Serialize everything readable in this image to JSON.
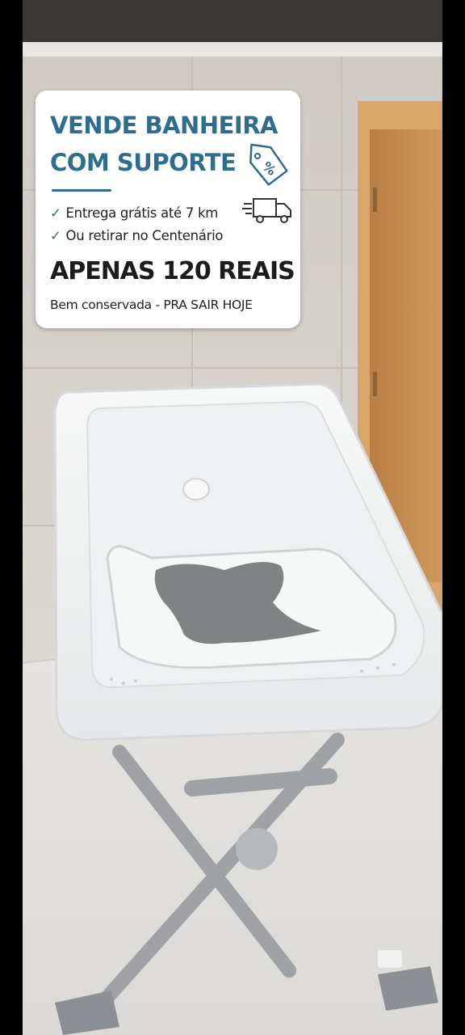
{
  "promo": {
    "headline_line1": "VENDE BANHEIRA",
    "headline_line2": "COM SUPORTE",
    "tag_icon": "price-tag-percent-icon",
    "truck_icon": "delivery-truck-icon",
    "check_mark": "✓",
    "bullet1": "Entrega grátis até 7 km",
    "bullet2": "Ou retirar no Centenário",
    "price": "APENAS 120 REAIS",
    "note": "Bem conservada - PRA SAIR HOJE"
  },
  "colors": {
    "accent": "#2e6d8c",
    "card_background": "#ffffff",
    "wall_tile": "#d8d3ce",
    "door_wood": "#c48a4e",
    "floor": "#e4e2df",
    "tub": "#f4f5f5",
    "seat_mat": "#7f8384"
  }
}
